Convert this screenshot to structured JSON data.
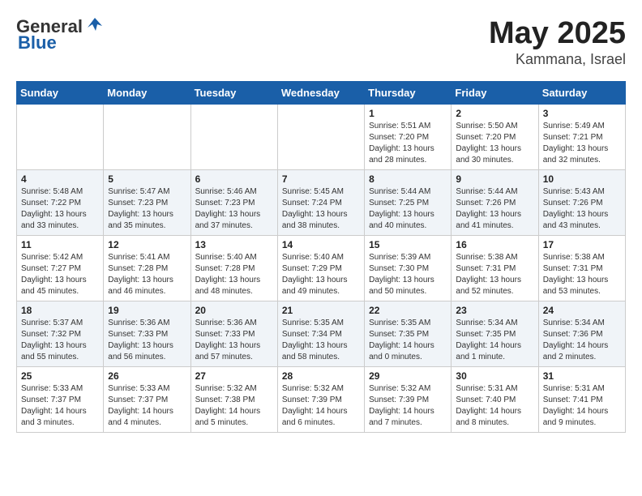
{
  "logo": {
    "general": "General",
    "blue": "Blue"
  },
  "title": "May 2025",
  "subtitle": "Kammana, Israel",
  "days_of_week": [
    "Sunday",
    "Monday",
    "Tuesday",
    "Wednesday",
    "Thursday",
    "Friday",
    "Saturday"
  ],
  "weeks": [
    [
      {
        "day": "",
        "info": ""
      },
      {
        "day": "",
        "info": ""
      },
      {
        "day": "",
        "info": ""
      },
      {
        "day": "",
        "info": ""
      },
      {
        "day": "1",
        "info": "Sunrise: 5:51 AM\nSunset: 7:20 PM\nDaylight: 13 hours\nand 28 minutes."
      },
      {
        "day": "2",
        "info": "Sunrise: 5:50 AM\nSunset: 7:20 PM\nDaylight: 13 hours\nand 30 minutes."
      },
      {
        "day": "3",
        "info": "Sunrise: 5:49 AM\nSunset: 7:21 PM\nDaylight: 13 hours\nand 32 minutes."
      }
    ],
    [
      {
        "day": "4",
        "info": "Sunrise: 5:48 AM\nSunset: 7:22 PM\nDaylight: 13 hours\nand 33 minutes."
      },
      {
        "day": "5",
        "info": "Sunrise: 5:47 AM\nSunset: 7:23 PM\nDaylight: 13 hours\nand 35 minutes."
      },
      {
        "day": "6",
        "info": "Sunrise: 5:46 AM\nSunset: 7:23 PM\nDaylight: 13 hours\nand 37 minutes."
      },
      {
        "day": "7",
        "info": "Sunrise: 5:45 AM\nSunset: 7:24 PM\nDaylight: 13 hours\nand 38 minutes."
      },
      {
        "day": "8",
        "info": "Sunrise: 5:44 AM\nSunset: 7:25 PM\nDaylight: 13 hours\nand 40 minutes."
      },
      {
        "day": "9",
        "info": "Sunrise: 5:44 AM\nSunset: 7:26 PM\nDaylight: 13 hours\nand 41 minutes."
      },
      {
        "day": "10",
        "info": "Sunrise: 5:43 AM\nSunset: 7:26 PM\nDaylight: 13 hours\nand 43 minutes."
      }
    ],
    [
      {
        "day": "11",
        "info": "Sunrise: 5:42 AM\nSunset: 7:27 PM\nDaylight: 13 hours\nand 45 minutes."
      },
      {
        "day": "12",
        "info": "Sunrise: 5:41 AM\nSunset: 7:28 PM\nDaylight: 13 hours\nand 46 minutes."
      },
      {
        "day": "13",
        "info": "Sunrise: 5:40 AM\nSunset: 7:28 PM\nDaylight: 13 hours\nand 48 minutes."
      },
      {
        "day": "14",
        "info": "Sunrise: 5:40 AM\nSunset: 7:29 PM\nDaylight: 13 hours\nand 49 minutes."
      },
      {
        "day": "15",
        "info": "Sunrise: 5:39 AM\nSunset: 7:30 PM\nDaylight: 13 hours\nand 50 minutes."
      },
      {
        "day": "16",
        "info": "Sunrise: 5:38 AM\nSunset: 7:31 PM\nDaylight: 13 hours\nand 52 minutes."
      },
      {
        "day": "17",
        "info": "Sunrise: 5:38 AM\nSunset: 7:31 PM\nDaylight: 13 hours\nand 53 minutes."
      }
    ],
    [
      {
        "day": "18",
        "info": "Sunrise: 5:37 AM\nSunset: 7:32 PM\nDaylight: 13 hours\nand 55 minutes."
      },
      {
        "day": "19",
        "info": "Sunrise: 5:36 AM\nSunset: 7:33 PM\nDaylight: 13 hours\nand 56 minutes."
      },
      {
        "day": "20",
        "info": "Sunrise: 5:36 AM\nSunset: 7:33 PM\nDaylight: 13 hours\nand 57 minutes."
      },
      {
        "day": "21",
        "info": "Sunrise: 5:35 AM\nSunset: 7:34 PM\nDaylight: 13 hours\nand 58 minutes."
      },
      {
        "day": "22",
        "info": "Sunrise: 5:35 AM\nSunset: 7:35 PM\nDaylight: 14 hours\nand 0 minutes."
      },
      {
        "day": "23",
        "info": "Sunrise: 5:34 AM\nSunset: 7:35 PM\nDaylight: 14 hours\nand 1 minute."
      },
      {
        "day": "24",
        "info": "Sunrise: 5:34 AM\nSunset: 7:36 PM\nDaylight: 14 hours\nand 2 minutes."
      }
    ],
    [
      {
        "day": "25",
        "info": "Sunrise: 5:33 AM\nSunset: 7:37 PM\nDaylight: 14 hours\nand 3 minutes."
      },
      {
        "day": "26",
        "info": "Sunrise: 5:33 AM\nSunset: 7:37 PM\nDaylight: 14 hours\nand 4 minutes."
      },
      {
        "day": "27",
        "info": "Sunrise: 5:32 AM\nSunset: 7:38 PM\nDaylight: 14 hours\nand 5 minutes."
      },
      {
        "day": "28",
        "info": "Sunrise: 5:32 AM\nSunset: 7:39 PM\nDaylight: 14 hours\nand 6 minutes."
      },
      {
        "day": "29",
        "info": "Sunrise: 5:32 AM\nSunset: 7:39 PM\nDaylight: 14 hours\nand 7 minutes."
      },
      {
        "day": "30",
        "info": "Sunrise: 5:31 AM\nSunset: 7:40 PM\nDaylight: 14 hours\nand 8 minutes."
      },
      {
        "day": "31",
        "info": "Sunrise: 5:31 AM\nSunset: 7:41 PM\nDaylight: 14 hours\nand 9 minutes."
      }
    ]
  ]
}
